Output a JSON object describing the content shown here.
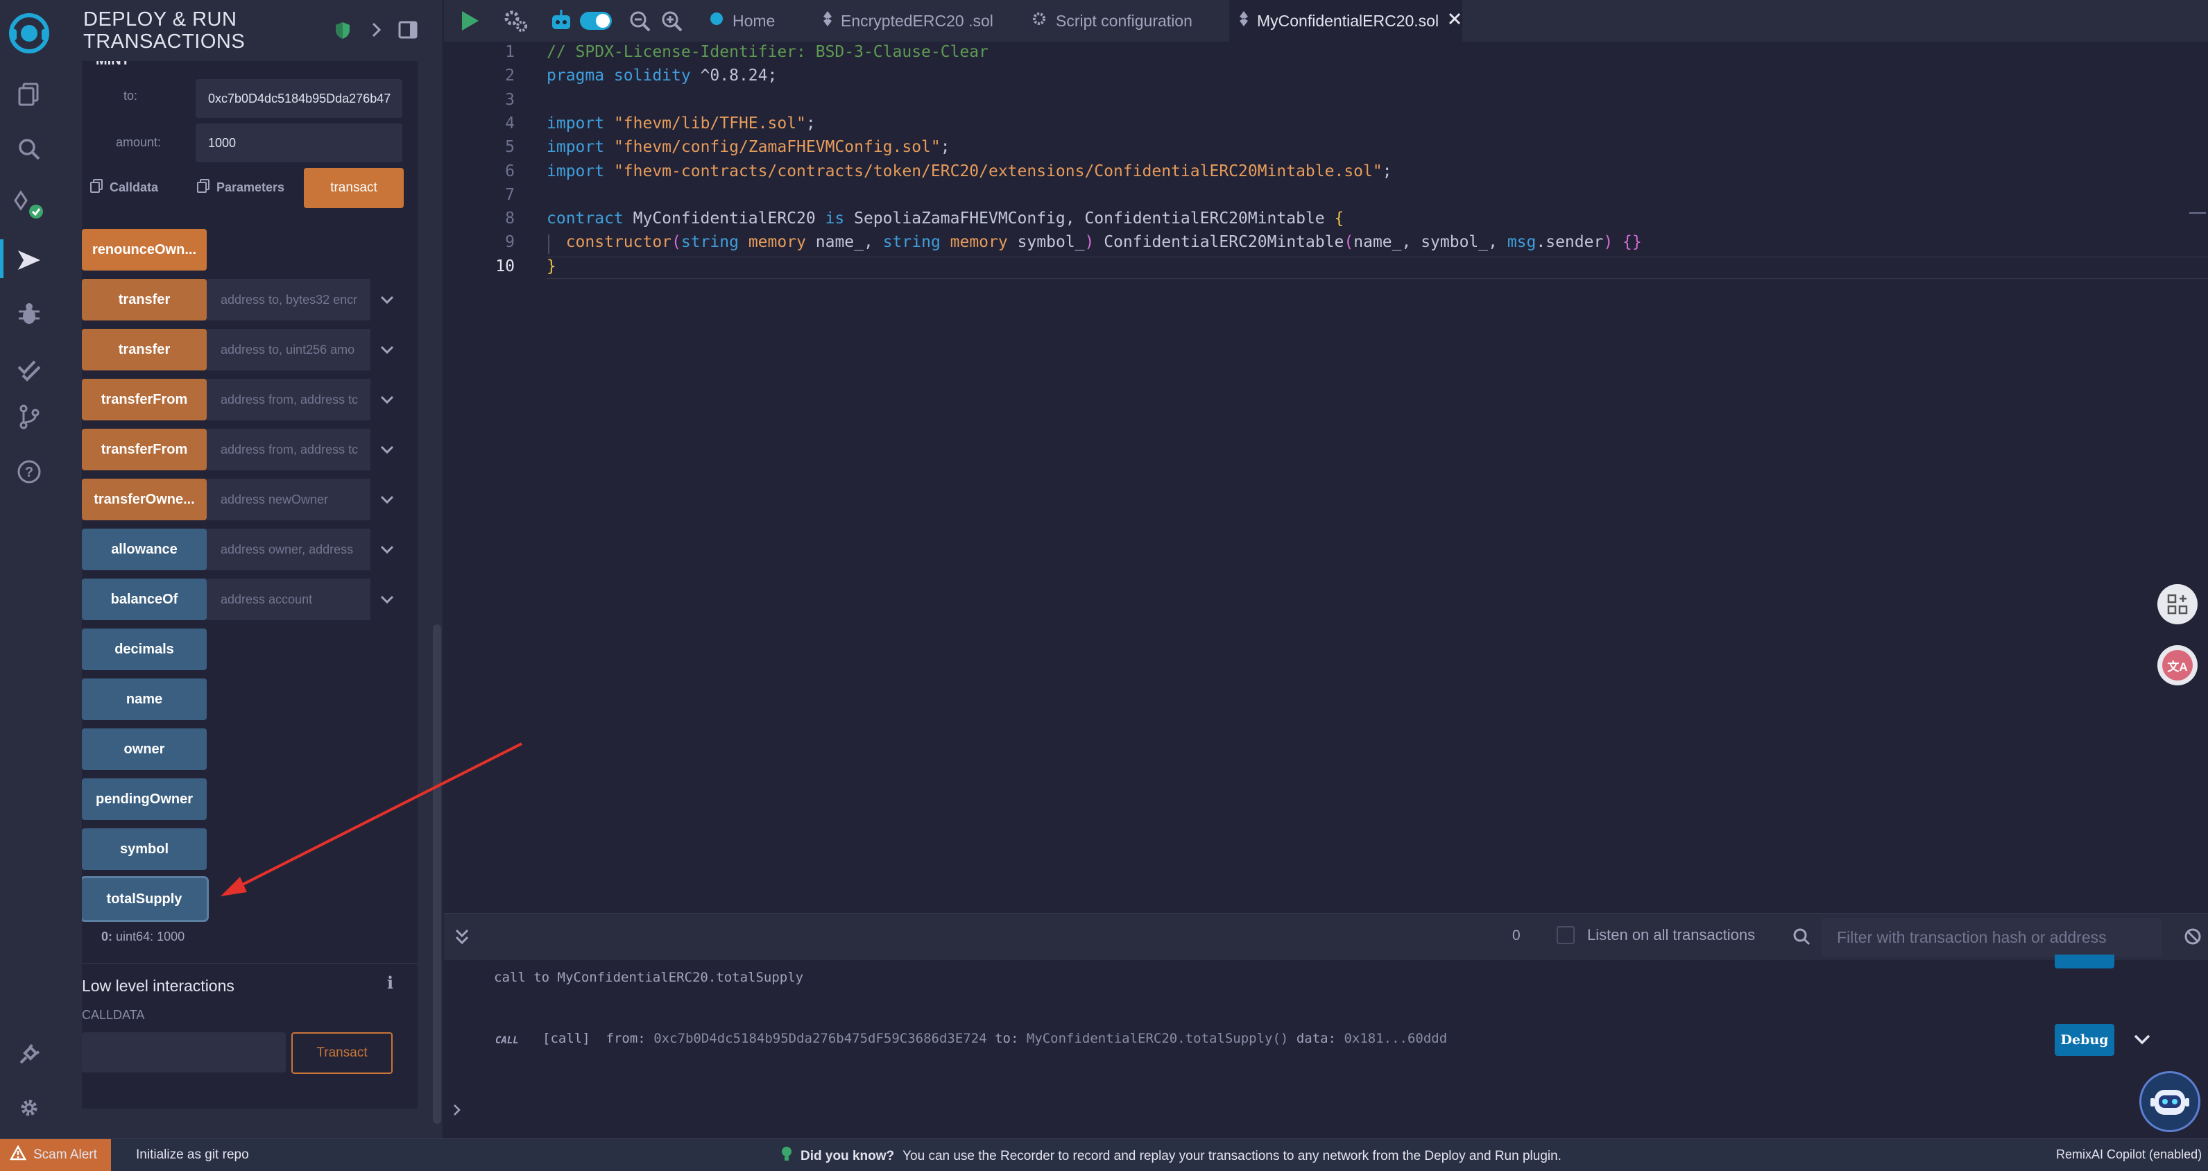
{
  "side_panel": {
    "title_line1": "DEPLOY & RUN",
    "title_line2": "TRANSACTIONS",
    "section_label": "MINT",
    "mint": {
      "to_label": "to:",
      "to_value": "0xc7b0D4dc5184b95Dda276b47",
      "amount_label": "amount:",
      "amount_value": "1000",
      "calldata_label": "Calldata",
      "parameters_label": "Parameters",
      "transact_label": "transact"
    },
    "functions": [
      {
        "name": "renounceOwn...",
        "kind": "write-strong",
        "placeholder": "",
        "expandable": false
      },
      {
        "name": "transfer",
        "kind": "write",
        "placeholder": "address to, bytes32 encr",
        "expandable": true
      },
      {
        "name": "transfer",
        "kind": "write",
        "placeholder": "address to, uint256 amo",
        "expandable": true
      },
      {
        "name": "transferFrom",
        "kind": "write",
        "placeholder": "address from, address tc",
        "expandable": true
      },
      {
        "name": "transferFrom",
        "kind": "write",
        "placeholder": "address from, address tc",
        "expandable": true
      },
      {
        "name": "transferOwne...",
        "kind": "write",
        "placeholder": "address newOwner",
        "expandable": true
      },
      {
        "name": "allowance",
        "kind": "read",
        "placeholder": "address owner, address",
        "expandable": true
      },
      {
        "name": "balanceOf",
        "kind": "read",
        "placeholder": "address account",
        "expandable": true
      },
      {
        "name": "decimals",
        "kind": "read",
        "placeholder": "",
        "expandable": false
      },
      {
        "name": "name",
        "kind": "read",
        "placeholder": "",
        "expandable": false
      },
      {
        "name": "owner",
        "kind": "read",
        "placeholder": "",
        "expandable": false
      },
      {
        "name": "pendingOwner",
        "kind": "read",
        "placeholder": "",
        "expandable": false
      },
      {
        "name": "symbol",
        "kind": "read",
        "placeholder": "",
        "expandable": false
      },
      {
        "name": "totalSupply",
        "kind": "read",
        "placeholder": "",
        "expandable": false
      }
    ],
    "result_index": "0:",
    "result_value": "uint64: 1000",
    "low_level_title": "Low level interactions",
    "calldata_caption": "CALLDATA",
    "low_level_transact": "Transact"
  },
  "tabs": [
    {
      "label": "Home",
      "icon": "remix-logo-icon"
    },
    {
      "label": "EncryptedERC20 .sol",
      "icon": "solidity-file-icon"
    },
    {
      "label": "Script configuration",
      "icon": "gear-icon"
    },
    {
      "label": "MyConfidentialERC20.sol",
      "icon": "solidity-file-icon",
      "active": true
    }
  ],
  "editor": {
    "line_numbers": [
      "1",
      "2",
      "3",
      "4",
      "5",
      "6",
      "7",
      "8",
      "9",
      "10"
    ],
    "lines": [
      [
        {
          "t": "// SPDX-License-Identifier: BSD-3-Clause-Clear",
          "c": "cm"
        }
      ],
      [
        {
          "t": "pragma solidity",
          "c": "k"
        },
        {
          "t": " ^0.8.24;",
          "c": ""
        }
      ],
      [],
      [
        {
          "t": "import",
          "c": "k"
        },
        {
          "t": " \"fhevm/lib/TFHE.sol\"",
          "c": "s"
        },
        {
          "t": ";",
          "c": ""
        }
      ],
      [
        {
          "t": "import",
          "c": "k"
        },
        {
          "t": " \"fhevm/config/ZamaFHEVMConfig.sol\"",
          "c": "s"
        },
        {
          "t": ";",
          "c": ""
        }
      ],
      [
        {
          "t": "import",
          "c": "k"
        },
        {
          "t": " \"fhevm-contracts/contracts/token/ERC20/extensions/ConfidentialERC20Mintable.sol\"",
          "c": "s"
        },
        {
          "t": ";",
          "c": ""
        }
      ],
      [],
      [
        {
          "t": "contract",
          "c": "k"
        },
        {
          "t": " MyConfidentialERC20 ",
          "c": ""
        },
        {
          "t": "is",
          "c": "k"
        },
        {
          "t": " SepoliaZamaFHEVMConfig, ConfidentialERC20Mintable ",
          "c": ""
        },
        {
          "t": "{",
          "c": "y"
        }
      ],
      [
        {
          "t": "  ",
          "c": ""
        },
        {
          "t": "constructor",
          "c": "s"
        },
        {
          "t": "(",
          "c": "p"
        },
        {
          "t": "string",
          "c": "k"
        },
        {
          "t": " memory",
          "c": "s"
        },
        {
          "t": " name_, ",
          "c": ""
        },
        {
          "t": "string",
          "c": "k"
        },
        {
          "t": " memory",
          "c": "s"
        },
        {
          "t": " symbol_",
          "c": ""
        },
        {
          "t": ")",
          "c": "p"
        },
        {
          "t": " ConfidentialERC20Mintable",
          "c": ""
        },
        {
          "t": "(",
          "c": "p"
        },
        {
          "t": "name_, symbol_, ",
          "c": ""
        },
        {
          "t": "msg",
          "c": "k"
        },
        {
          "t": ".sender",
          "c": ""
        },
        {
          "t": ")",
          "c": "p"
        },
        {
          "t": " {}",
          "c": "p"
        }
      ],
      [
        {
          "t": "}",
          "c": "y"
        }
      ]
    ]
  },
  "terminal": {
    "count": "0",
    "listen_label": "Listen on all transactions",
    "filter_placeholder": "Filter with transaction hash or address",
    "call_line": "call to MyConfidentialERC20.totalSupply",
    "call_badge": "CALL",
    "log_tag": "[call]",
    "from_label": "from:",
    "from_value": "0xc7b0D4dc5184b95Dda276b475dF59C3686d3E724",
    "to_label": "to:",
    "to_value": "MyConfidentialERC20.totalSupply()",
    "data_label": "data:",
    "data_value": "0x181...60ddd",
    "debug_label": "Debug"
  },
  "statusbar": {
    "scam_alert": "Scam Alert",
    "git_label": "Initialize as git repo",
    "tip_title": "Did you know?",
    "tip_text": "You can use the Recorder to record and replay your transactions to any network from the Deploy and Run plugin.",
    "copilot": "RemixAI Copilot (enabled)"
  },
  "colors": {
    "accent_blue": "#1ea7d6",
    "write_button": "#c97539",
    "read_button": "#3b5f80",
    "annotation_arrow": "#e5312b",
    "scam_alert_bg": "#c96b36"
  }
}
